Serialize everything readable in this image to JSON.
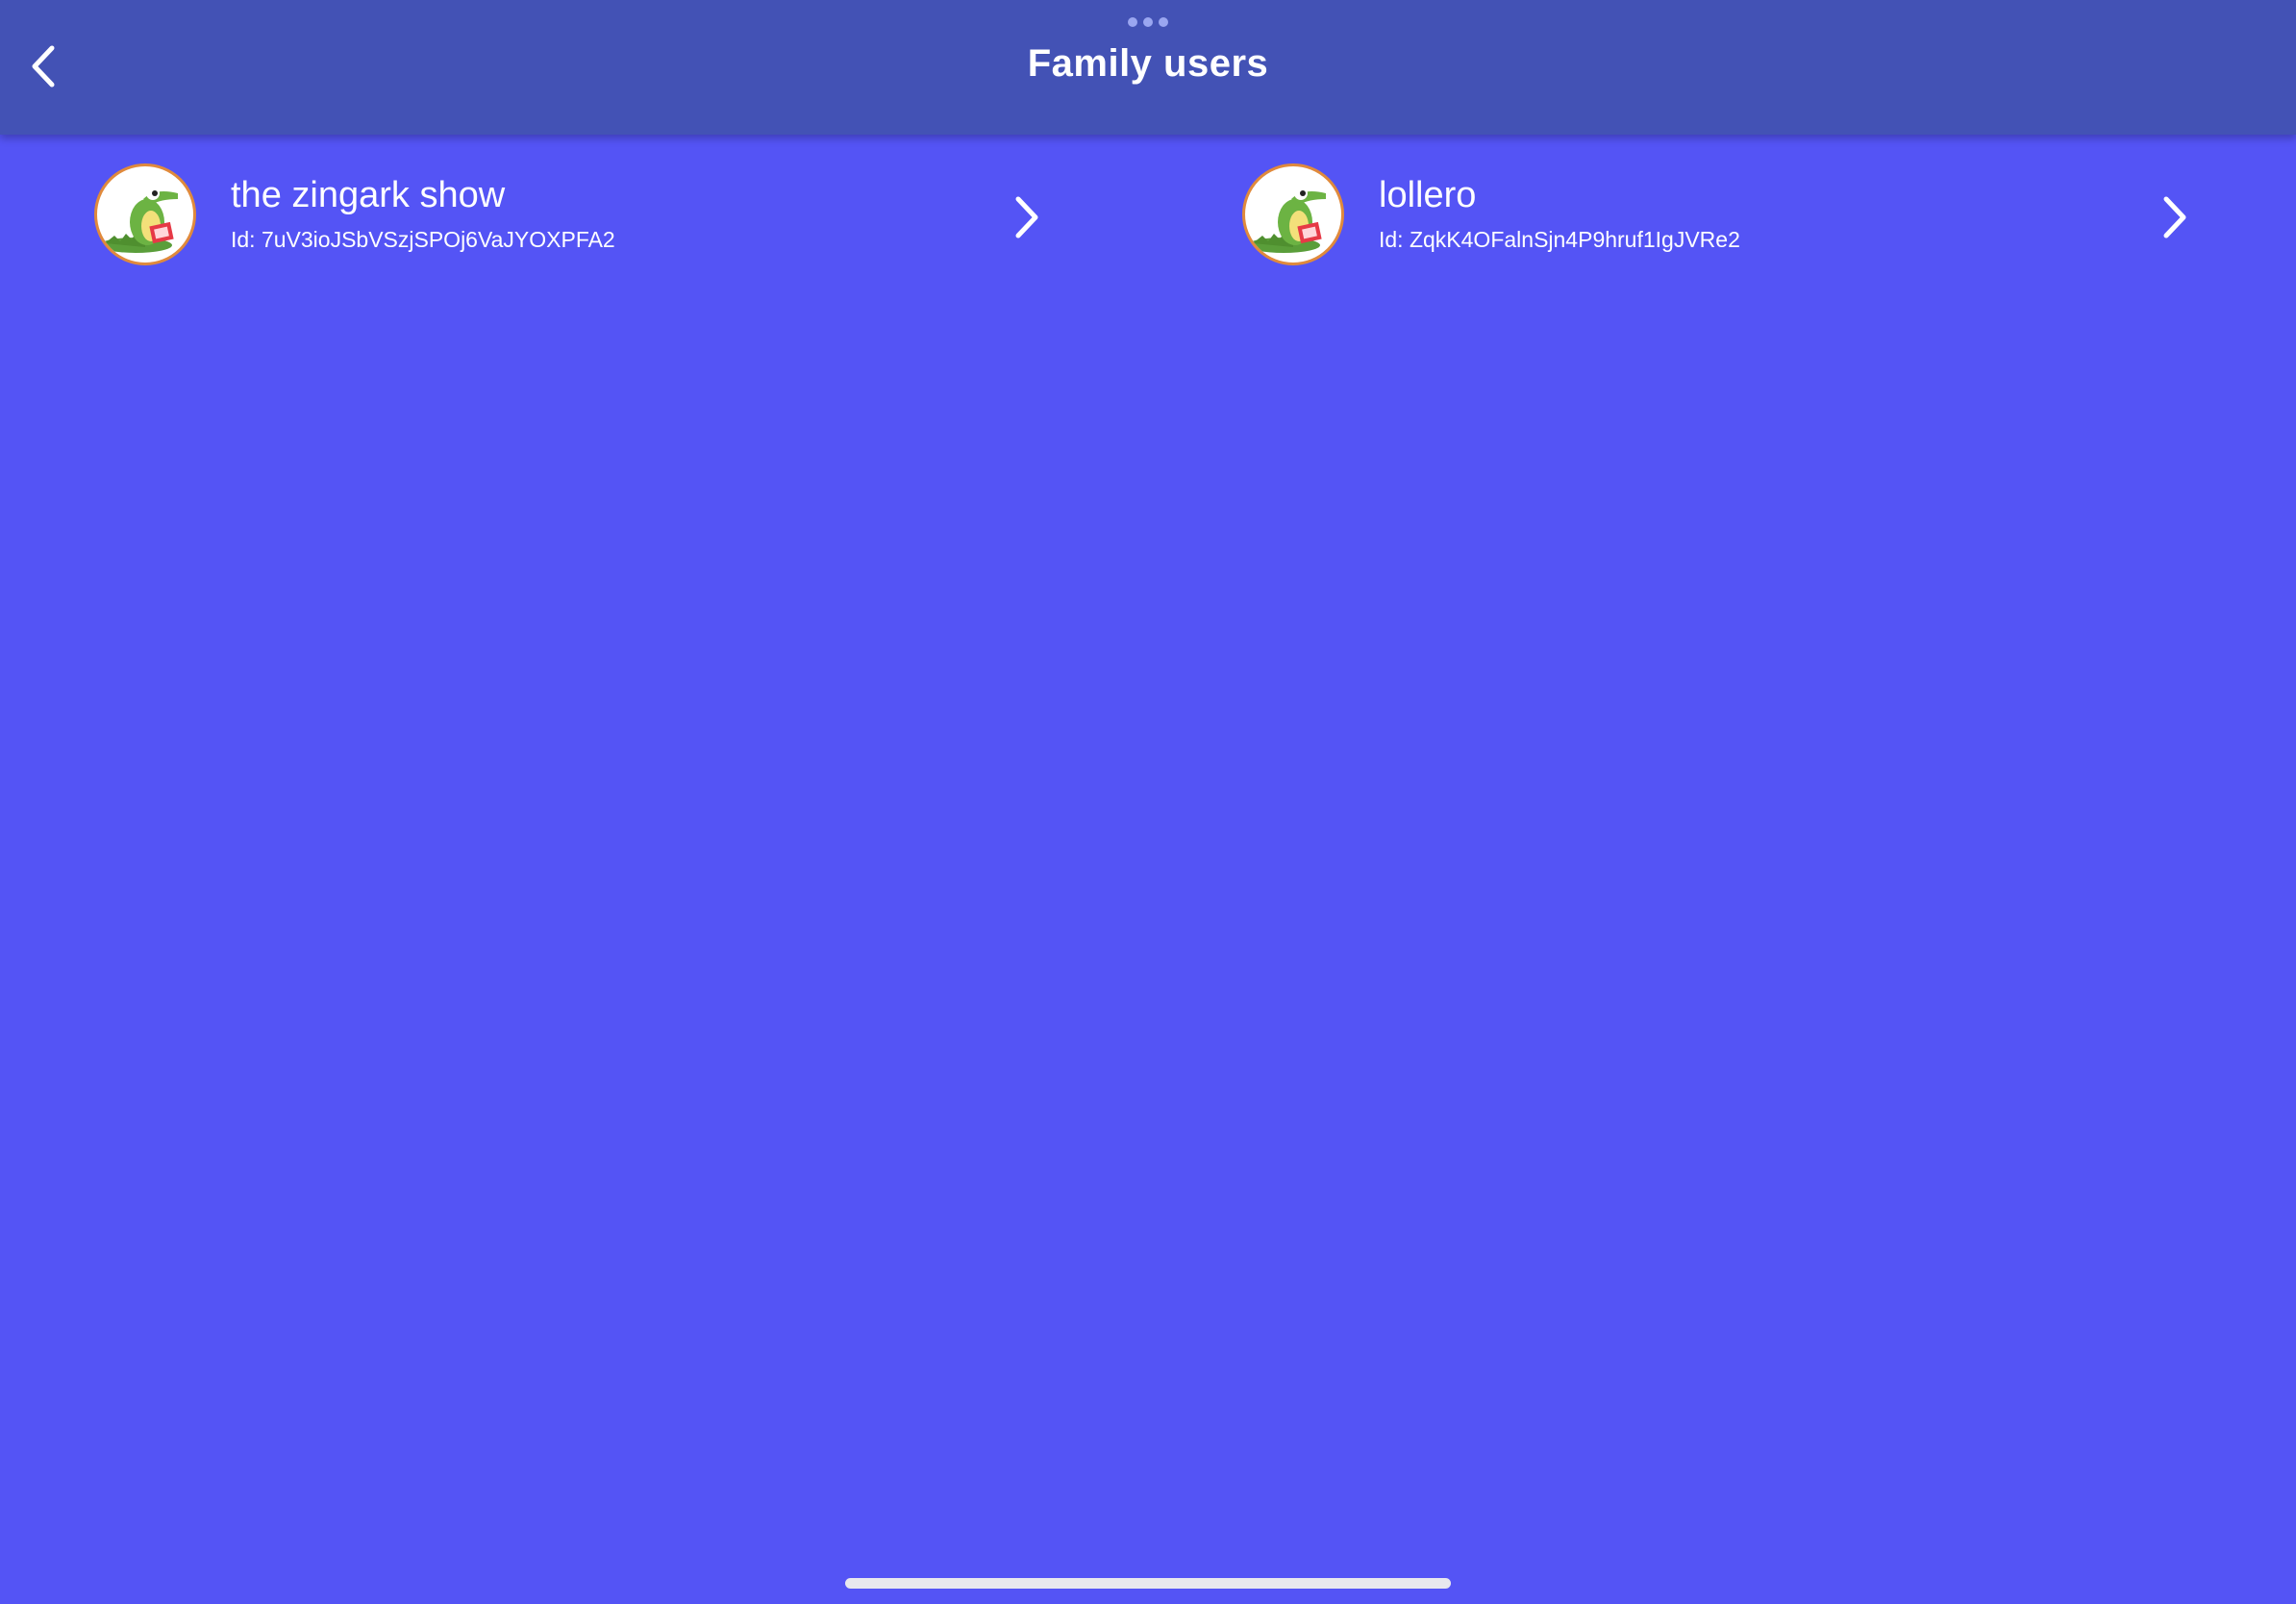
{
  "header": {
    "title": "Family users",
    "back_icon": "chevron-left-icon",
    "grabber_icon": "more-dots-icon"
  },
  "users": [
    {
      "name": "the zingark show",
      "id_text": "Id: 7uV3ioJSbVSzjSPOj6VaJYOXPFA2",
      "avatar": "crocodile-avatar-icon",
      "chevron": "chevron-right-icon"
    },
    {
      "name": "lollero",
      "id_text": "Id: ZqkK4OFalnSjn4P9hruf1IgJVRe2",
      "avatar": "crocodile-avatar-icon",
      "chevron": "chevron-right-icon"
    }
  ],
  "colors": {
    "background": "#5454f5",
    "header": "#4352b5",
    "text": "#ffffff",
    "avatar_border": "#e08a3c"
  }
}
